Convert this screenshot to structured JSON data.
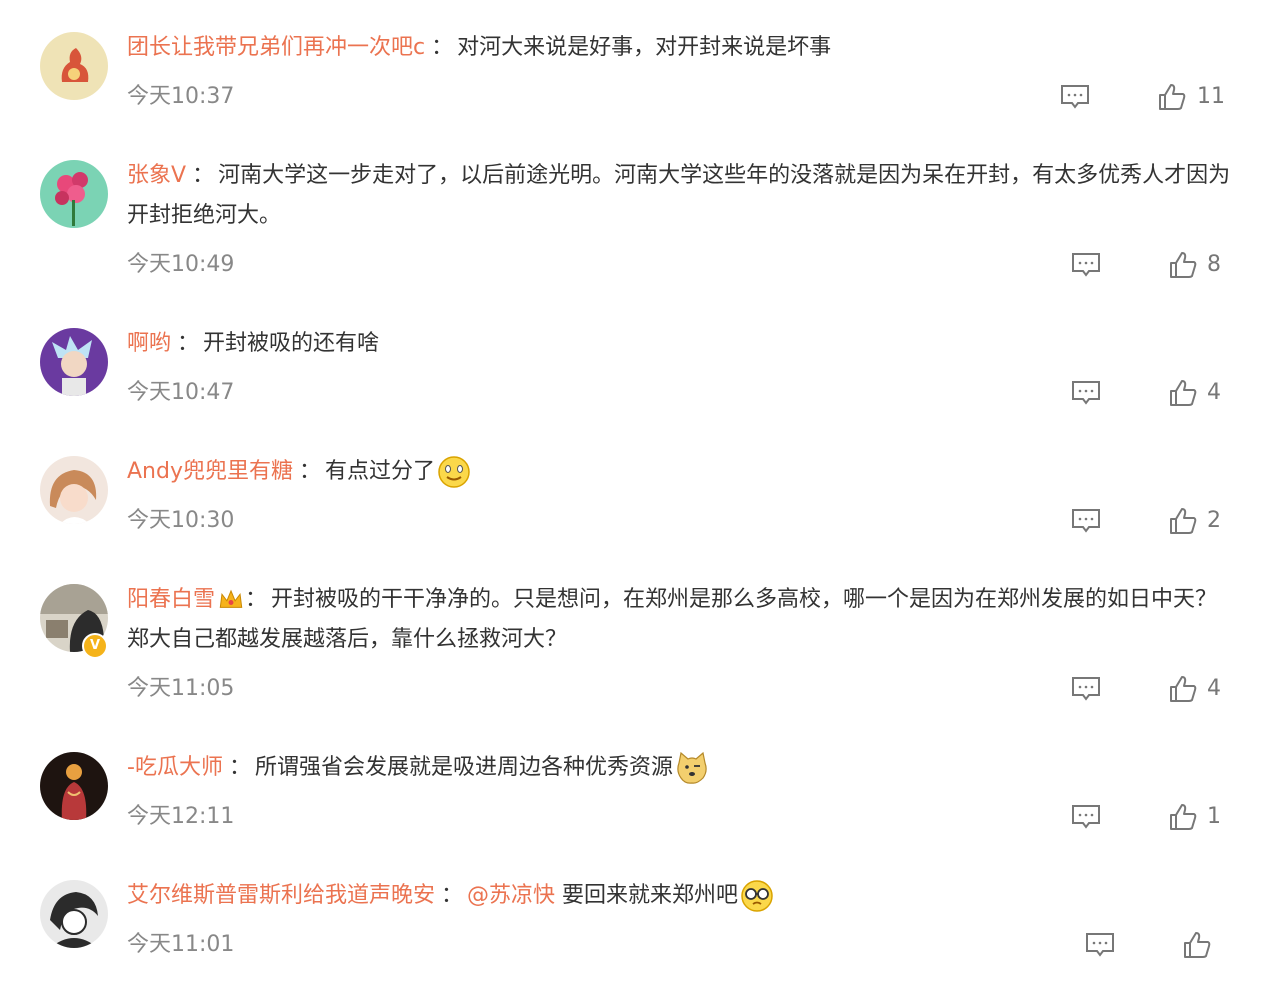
{
  "comments": [
    {
      "user": "团长让我带兄弟们再冲一次吧c",
      "text": "对河大来说是好事，对开封来说是坏事",
      "time": "今天10:37",
      "likes": "11"
    },
    {
      "user": "张象V",
      "text": "河南大学这一步走对了，以后前途光明。河南大学这些年的没落就是因为呆在开封，有太多优秀人才因为开封拒绝河大。",
      "time": "今天10:49",
      "likes": "8"
    },
    {
      "user": "啊哟",
      "text": "开封被吸的还有啥",
      "time": "今天10:47",
      "likes": "4"
    },
    {
      "user": "Andy兜兜里有糖",
      "text": "有点过分了",
      "time": "今天10:30",
      "likes": "2"
    },
    {
      "user": "阳春白雪",
      "text": "开封被吸的干干净净的。只是想问，在郑州是那么多高校，哪一个是因为在郑州发展的如日中天？郑大自己都越发展越落后，靠什么拯救河大？",
      "time": "今天11:05",
      "likes": "4",
      "badge": "V"
    },
    {
      "user": "-吃瓜大师",
      "text": "所谓强省会发展就是吸进周边各种优秀资源",
      "time": "今天12:11",
      "likes": "1"
    },
    {
      "user": "艾尔维斯普雷斯利给我道声晚安",
      "mention": "@苏凉快",
      "text": "要回来就来郑州吧",
      "time": "今天11:01",
      "likes": ""
    }
  ],
  "separator": "：",
  "colors": {
    "username": "#eb7350",
    "text": "#333333",
    "time": "#888888"
  }
}
